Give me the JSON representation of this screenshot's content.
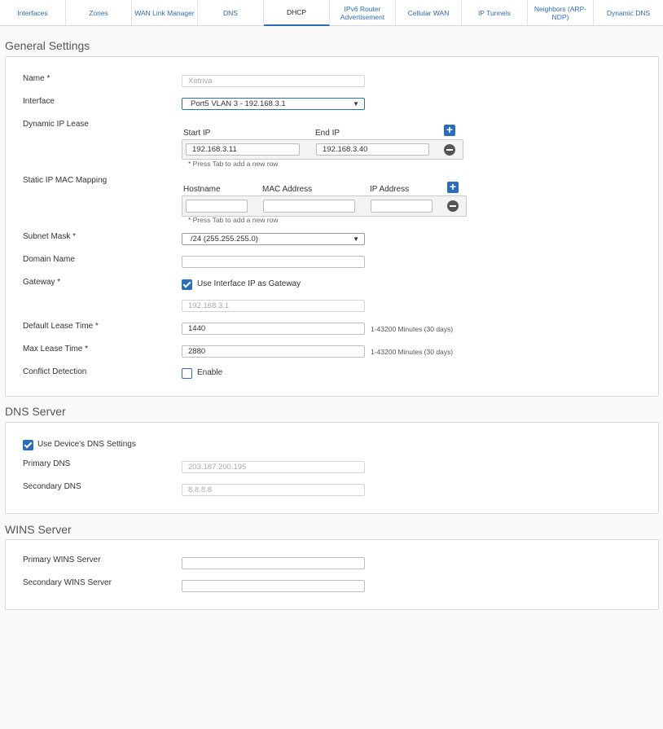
{
  "tabs": [
    {
      "label": "Interfaces"
    },
    {
      "label": "Zones"
    },
    {
      "label": "WAN Link Manager"
    },
    {
      "label": "DNS"
    },
    {
      "label": "DHCP"
    },
    {
      "label": "IPv6 Router Advertisement"
    },
    {
      "label": "Cellular WAN"
    },
    {
      "label": "IP Tunnels"
    },
    {
      "label": "Neighbors (ARP-NDP)"
    },
    {
      "label": "Dynamic DNS"
    }
  ],
  "active_tab": "DHCP",
  "general": {
    "title": "General Settings",
    "name_label": "Name *",
    "name_value": "Xetriva",
    "interface_label": "Interface",
    "interface_value": "Port5 VLAN 3 - 192.168.3.1",
    "dyn_lease_label": "Dynamic IP Lease",
    "start_ip_header": "Start IP",
    "end_ip_header": "End IP",
    "start_ip_value": "192.168.3.11",
    "end_ip_value": "192.168.3.40",
    "press_tab_hint_1": "* Press Tab to add a new row",
    "static_label": "Static IP MAC Mapping",
    "hostname_header": "Hostname",
    "mac_header": "MAC Address",
    "ip_header": "IP Address",
    "press_tab_hint_2": "* Press Tab to add a new row",
    "subnet_label": "Subnet Mask *",
    "subnet_value": "/24 (255.255.255.0)",
    "domain_label": "Domain Name",
    "domain_value": "",
    "gateway_label": "Gateway *",
    "gateway_checkbox_label": "Use Interface IP as Gateway",
    "gateway_value": "192.168.3.1",
    "default_lease_label": "Default Lease Time *",
    "default_lease_value": "1440",
    "default_lease_range": "1-43200 Minutes (30 days)",
    "max_lease_label": "Max Lease Time *",
    "max_lease_value": "2880",
    "max_lease_range": "1-43200 Minutes (30 days)",
    "conflict_label": "Conflict Detection",
    "conflict_checkbox_label": "Enable"
  },
  "dns": {
    "title": "DNS Server",
    "use_device_label": "Use Device's DNS Settings",
    "primary_label": "Primary DNS",
    "primary_value": "203.187.200.195",
    "secondary_label": "Secondary DNS",
    "secondary_value": "8.8.8.8"
  },
  "wins": {
    "title": "WINS Server",
    "primary_label": "Primary WINS Server",
    "secondary_label": "Secondary WINS Server"
  },
  "icons": {
    "plus": "plus-icon",
    "minus": "minus-circle-icon",
    "dropdown": "triangle-down-icon"
  },
  "colors": {
    "accent": "#2a6ebb",
    "background": "#fafafa"
  }
}
